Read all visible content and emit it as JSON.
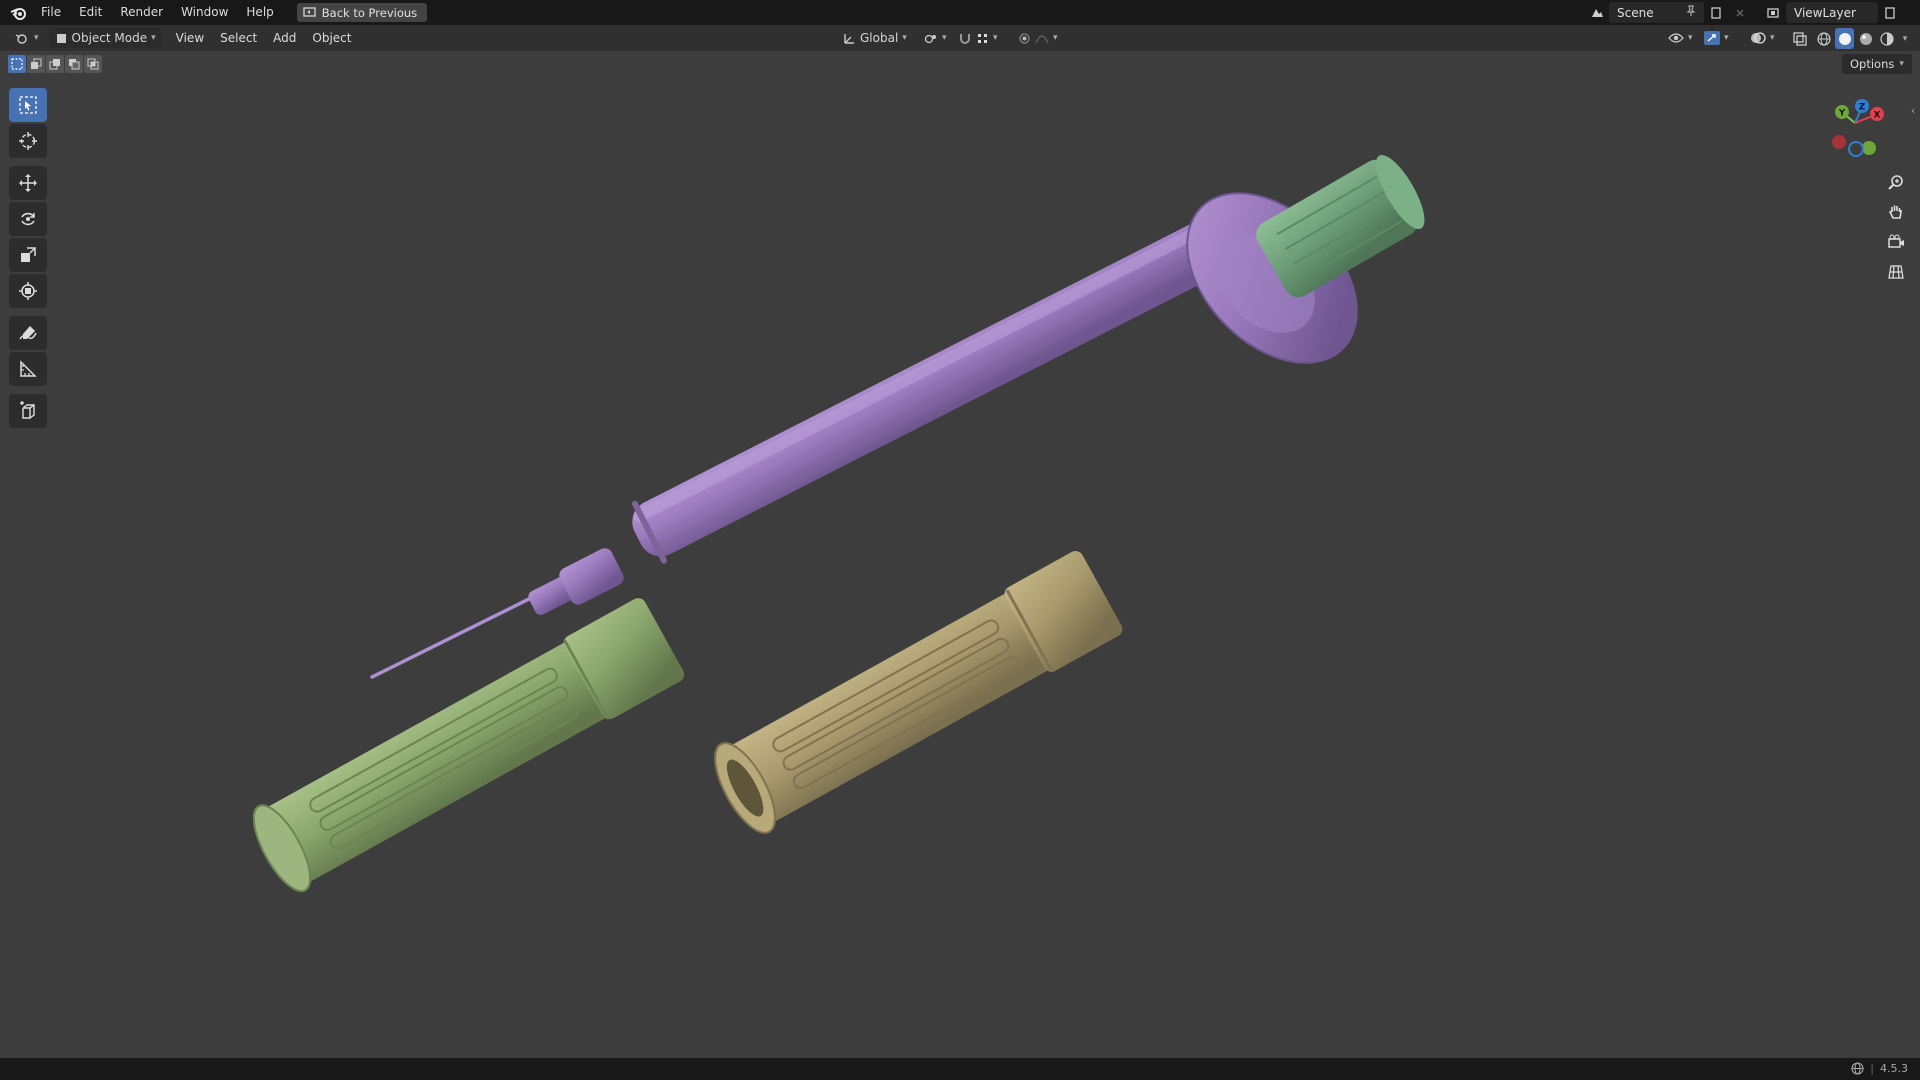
{
  "topbar": {
    "menus": [
      "File",
      "Edit",
      "Render",
      "Window",
      "Help"
    ],
    "back_label": "Back to Previous",
    "scene_label": "Scene",
    "viewlayer_label": "ViewLayer"
  },
  "header": {
    "mode_label": "Object Mode",
    "menus": [
      "View",
      "Select",
      "Add",
      "Object"
    ],
    "orientation_label": "Global"
  },
  "viewport": {
    "options_label": "Options",
    "gizmo_axes": {
      "x": "X",
      "y": "Y",
      "z": "Z"
    },
    "objects": [
      {
        "name": "syringe",
        "color": "#9a7bbd"
      },
      {
        "name": "plunger-cap",
        "color": "#6fa07a"
      },
      {
        "name": "needle-cap-green",
        "color": "#8aa56d"
      },
      {
        "name": "needle-cap-khaki",
        "color": "#a99a6d"
      }
    ]
  },
  "tools": [
    "select-box-icon",
    "cursor-icon",
    "move-icon",
    "rotate-icon",
    "scale-icon",
    "transform-icon",
    "annotate-icon",
    "measure-icon",
    "add-cube-icon"
  ],
  "statusbar": {
    "version": "4.5.3"
  },
  "colors": {
    "background": "#3d3d3d",
    "accent": "#4772b3",
    "topbar": "#181818",
    "header": "#303030"
  }
}
